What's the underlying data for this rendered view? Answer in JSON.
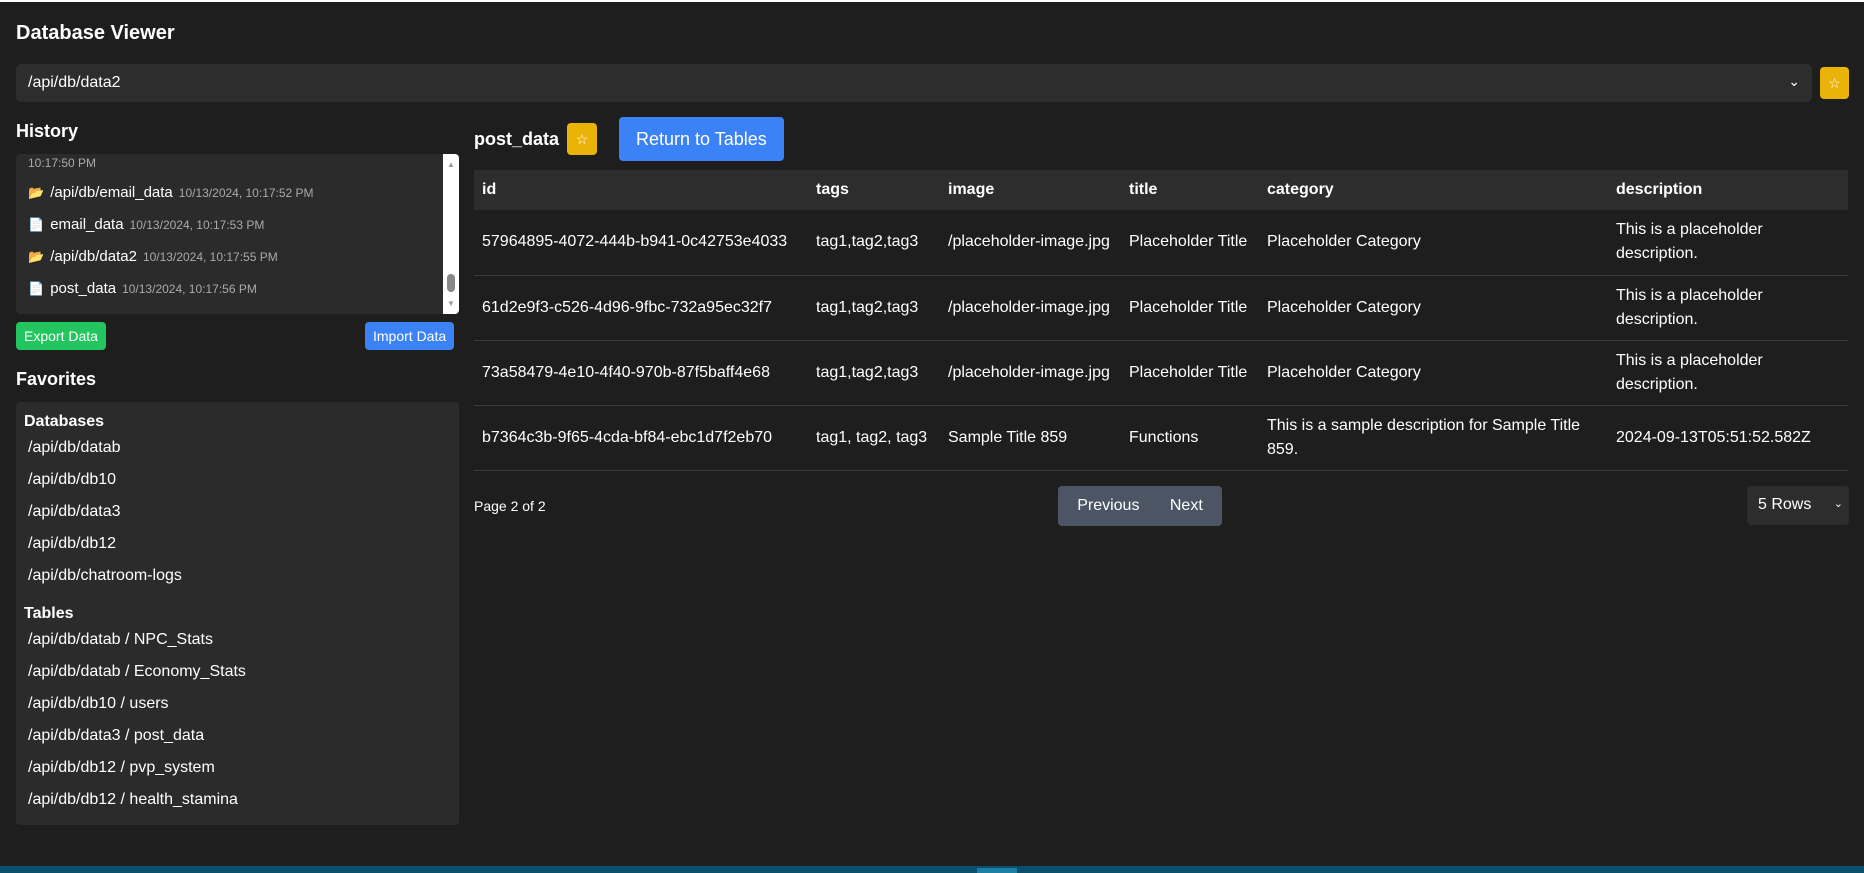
{
  "app": {
    "title": "Database Viewer"
  },
  "top_select": {
    "value": "/api/db/data2"
  },
  "history": {
    "title": "History",
    "partial_ts": "10:17:50 PM",
    "items": [
      {
        "type": "folder",
        "label": "/api/db/email_data",
        "ts": "10/13/2024, 10:17:52 PM"
      },
      {
        "type": "file",
        "label": "email_data",
        "ts": "10/13/2024, 10:17:53 PM"
      },
      {
        "type": "folder",
        "label": "/api/db/data2",
        "ts": "10/13/2024, 10:17:55 PM"
      },
      {
        "type": "file",
        "label": "post_data",
        "ts": "10/13/2024, 10:17:56 PM"
      }
    ],
    "export_label": "Export Data",
    "import_label": "Import Data"
  },
  "favorites": {
    "title": "Favorites",
    "db_heading": "Databases",
    "databases": [
      "/api/db/datab",
      "/api/db/db10",
      "/api/db/data3",
      "/api/db/db12",
      "/api/db/chatroom-logs"
    ],
    "tables_heading": "Tables",
    "tables": [
      "/api/db/datab / NPC_Stats",
      "/api/db/datab / Economy_Stats",
      "/api/db/db10 / users",
      "/api/db/data3 / post_data",
      "/api/db/db12 / pvp_system",
      "/api/db/db12 / health_stamina"
    ]
  },
  "main": {
    "table_name": "post_data",
    "star": "☆",
    "return_label": "Return to Tables",
    "columns": [
      "id",
      "tags",
      "image",
      "title",
      "category",
      "description"
    ],
    "rows": [
      [
        "57964895-4072-444b-b941-0c42753e4033",
        "tag1,tag2,tag3",
        "/placeholder-image.jpg",
        "Placeholder Title",
        "Placeholder Category",
        "This is a placeholder description."
      ],
      [
        "61d2e9f3-c526-4d96-9fbc-732a95ec32f7",
        "tag1,tag2,tag3",
        "/placeholder-image.jpg",
        "Placeholder Title",
        "Placeholder Category",
        "This is a placeholder description."
      ],
      [
        "73a58479-4e10-4f40-970b-87f5baff4e68",
        "tag1,tag2,tag3",
        "/placeholder-image.jpg",
        "Placeholder Title",
        "Placeholder Category",
        "This is a placeholder description."
      ],
      [
        "b7364c3b-9f65-4cda-bf84-ebc1d7f2eb70",
        "tag1, tag2, tag3",
        "Sample Title 859",
        "Functions",
        "This is a sample description for Sample Title 859.",
        "2024-09-13T05:51:52.582Z"
      ]
    ],
    "page_info": "Page 2 of 2",
    "prev_label": "Previous",
    "next_label": "Next",
    "rows_select": "5 Rows"
  }
}
